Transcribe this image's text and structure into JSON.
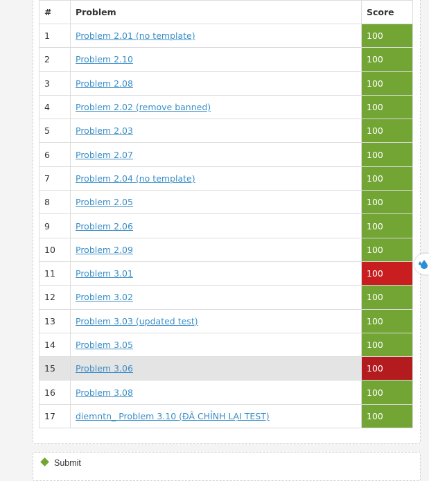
{
  "table": {
    "headers": {
      "num": "#",
      "problem": "Problem",
      "score": "Score"
    },
    "rows": [
      {
        "num": "1",
        "problem": "Problem 2.01 (no template)",
        "score": "100",
        "status": "ok"
      },
      {
        "num": "2",
        "problem": "Problem 2.10",
        "score": "100",
        "status": "ok"
      },
      {
        "num": "3",
        "problem": "Problem 2.08",
        "score": "100",
        "status": "ok"
      },
      {
        "num": "4",
        "problem": "Problem 2.02 (remove banned)",
        "score": "100",
        "status": "ok"
      },
      {
        "num": "5",
        "problem": "Problem 2.03",
        "score": "100",
        "status": "ok"
      },
      {
        "num": "6",
        "problem": "Problem 2.07",
        "score": "100",
        "status": "ok"
      },
      {
        "num": "7",
        "problem": "Problem 2.04 (no template)",
        "score": "100",
        "status": "ok"
      },
      {
        "num": "8",
        "problem": "Problem 2.05",
        "score": "100",
        "status": "ok"
      },
      {
        "num": "9",
        "problem": "Problem 2.06",
        "score": "100",
        "status": "ok"
      },
      {
        "num": "10",
        "problem": "Problem 2.09",
        "score": "100",
        "status": "ok"
      },
      {
        "num": "11",
        "problem": "Problem 3.01",
        "score": "100",
        "status": "bad"
      },
      {
        "num": "12",
        "problem": "Problem 3.02",
        "score": "100",
        "status": "ok"
      },
      {
        "num": "13",
        "problem": "Problem 3.03 (updated test)",
        "score": "100",
        "status": "ok"
      },
      {
        "num": "14",
        "problem": "Problem 3.05",
        "score": "100",
        "status": "ok"
      },
      {
        "num": "15",
        "problem": "Problem 3.06",
        "score": "100",
        "status": "bad",
        "highlighted": true
      },
      {
        "num": "16",
        "problem": "Problem 3.08",
        "score": "100",
        "status": "ok"
      },
      {
        "num": "17",
        "problem": "diemntn_ Problem 3.10 (ĐÃ CHỈNH LẠI TEST)",
        "score": "100",
        "status": "ok"
      }
    ]
  },
  "bottom": {
    "label": "Submit"
  },
  "side_widget": {
    "icon": "droplet-icon"
  },
  "colors": {
    "ok": "#72a534",
    "bad": "#c81e20",
    "link": "#3a8ec8"
  }
}
